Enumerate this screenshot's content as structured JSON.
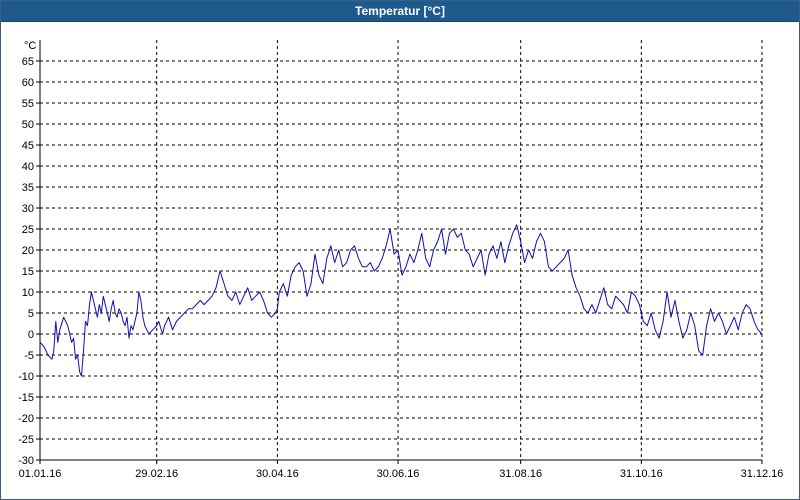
{
  "window": {
    "title": "Temperatur [°C]"
  },
  "chart_data": {
    "type": "line",
    "title": "Temperatur [°C]",
    "ylabel": "°C",
    "xlabel": "",
    "ylim": [
      -30,
      70
    ],
    "yticks": [
      -30,
      -25,
      -20,
      -15,
      -10,
      -5,
      0,
      5,
      10,
      15,
      20,
      25,
      30,
      35,
      40,
      45,
      50,
      55,
      60,
      65
    ],
    "x_ticks": [
      "01.01.16",
      "29.02.16",
      "30.04.16",
      "30.06.16",
      "31.08.16",
      "31.10.16",
      "31.12.16"
    ],
    "x_tick_days": [
      0,
      59,
      120,
      181,
      243,
      304,
      365
    ],
    "grid": true,
    "line_color": "#1010b0",
    "series": [
      {
        "name": "",
        "points": [
          [
            0,
            -2
          ],
          [
            2,
            -3
          ],
          [
            4,
            -5
          ],
          [
            6,
            -6
          ],
          [
            7,
            -4
          ],
          [
            8,
            3
          ],
          [
            9,
            -2
          ],
          [
            10,
            1
          ],
          [
            12,
            4
          ],
          [
            14,
            2
          ],
          [
            15,
            0
          ],
          [
            16,
            -2
          ],
          [
            17,
            -1
          ],
          [
            18,
            -6
          ],
          [
            19,
            -5
          ],
          [
            20,
            -9
          ],
          [
            21,
            -10
          ],
          [
            22,
            -4
          ],
          [
            23,
            3
          ],
          [
            24,
            2
          ],
          [
            25,
            7
          ],
          [
            26,
            10
          ],
          [
            27,
            8
          ],
          [
            28,
            6
          ],
          [
            29,
            4
          ],
          [
            30,
            7
          ],
          [
            31,
            5
          ],
          [
            32,
            9
          ],
          [
            33,
            7
          ],
          [
            34,
            5
          ],
          [
            35,
            3
          ],
          [
            36,
            6
          ],
          [
            37,
            8
          ],
          [
            38,
            5
          ],
          [
            39,
            4
          ],
          [
            40,
            6
          ],
          [
            41,
            5
          ],
          [
            42,
            3
          ],
          [
            43,
            2
          ],
          [
            44,
            4
          ],
          [
            45,
            -1
          ],
          [
            46,
            2
          ],
          [
            47,
            1
          ],
          [
            48,
            3
          ],
          [
            49,
            5
          ],
          [
            50,
            10
          ],
          [
            51,
            8
          ],
          [
            52,
            4
          ],
          [
            53,
            2
          ],
          [
            54,
            1
          ],
          [
            55,
            0
          ],
          [
            57,
            1
          ],
          [
            59,
            2
          ],
          [
            60,
            3
          ],
          [
            62,
            0
          ],
          [
            63,
            2
          ],
          [
            65,
            4
          ],
          [
            67,
            1
          ],
          [
            69,
            3
          ],
          [
            71,
            4
          ],
          [
            73,
            5
          ],
          [
            75,
            6
          ],
          [
            77,
            6
          ],
          [
            79,
            7
          ],
          [
            81,
            8
          ],
          [
            83,
            7
          ],
          [
            85,
            8
          ],
          [
            87,
            9
          ],
          [
            89,
            11
          ],
          [
            91,
            15
          ],
          [
            93,
            12
          ],
          [
            95,
            9
          ],
          [
            97,
            8
          ],
          [
            99,
            10
          ],
          [
            101,
            7
          ],
          [
            103,
            9
          ],
          [
            105,
            11
          ],
          [
            107,
            8
          ],
          [
            109,
            9
          ],
          [
            111,
            10
          ],
          [
            113,
            8
          ],
          [
            115,
            5
          ],
          [
            117,
            4
          ],
          [
            119,
            5
          ],
          [
            120,
            6
          ],
          [
            121,
            10
          ],
          [
            123,
            12
          ],
          [
            125,
            9
          ],
          [
            127,
            14
          ],
          [
            129,
            16
          ],
          [
            131,
            17
          ],
          [
            133,
            15
          ],
          [
            135,
            9
          ],
          [
            137,
            12
          ],
          [
            139,
            19
          ],
          [
            141,
            14
          ],
          [
            143,
            12
          ],
          [
            145,
            18
          ],
          [
            147,
            21
          ],
          [
            149,
            17
          ],
          [
            151,
            20
          ],
          [
            153,
            16
          ],
          [
            155,
            17
          ],
          [
            157,
            20
          ],
          [
            159,
            21
          ],
          [
            161,
            18
          ],
          [
            163,
            16
          ],
          [
            165,
            16
          ],
          [
            167,
            17
          ],
          [
            169,
            15
          ],
          [
            171,
            16
          ],
          [
            173,
            18
          ],
          [
            175,
            21
          ],
          [
            177,
            25
          ],
          [
            179,
            19
          ],
          [
            181,
            20
          ],
          [
            183,
            14
          ],
          [
            185,
            16
          ],
          [
            187,
            19
          ],
          [
            189,
            17
          ],
          [
            191,
            20
          ],
          [
            193,
            24
          ],
          [
            195,
            18
          ],
          [
            197,
            16
          ],
          [
            199,
            20
          ],
          [
            201,
            22
          ],
          [
            203,
            25
          ],
          [
            205,
            19
          ],
          [
            207,
            24
          ],
          [
            209,
            25
          ],
          [
            211,
            23
          ],
          [
            213,
            24
          ],
          [
            215,
            20
          ],
          [
            217,
            19
          ],
          [
            219,
            16
          ],
          [
            221,
            18
          ],
          [
            223,
            20
          ],
          [
            225,
            14
          ],
          [
            227,
            19
          ],
          [
            229,
            21
          ],
          [
            231,
            18
          ],
          [
            233,
            22
          ],
          [
            235,
            17
          ],
          [
            237,
            21
          ],
          [
            239,
            24
          ],
          [
            241,
            26
          ],
          [
            243,
            22
          ],
          [
            245,
            17
          ],
          [
            247,
            20
          ],
          [
            249,
            18
          ],
          [
            251,
            22
          ],
          [
            253,
            24
          ],
          [
            255,
            22
          ],
          [
            257,
            16
          ],
          [
            259,
            15
          ],
          [
            261,
            16
          ],
          [
            263,
            17
          ],
          [
            265,
            18
          ],
          [
            267,
            20
          ],
          [
            269,
            14
          ],
          [
            271,
            11
          ],
          [
            273,
            9
          ],
          [
            275,
            6
          ],
          [
            277,
            5
          ],
          [
            279,
            7
          ],
          [
            281,
            5
          ],
          [
            283,
            8
          ],
          [
            285,
            11
          ],
          [
            287,
            7
          ],
          [
            289,
            6
          ],
          [
            291,
            9
          ],
          [
            293,
            8
          ],
          [
            295,
            7
          ],
          [
            297,
            5
          ],
          [
            299,
            10
          ],
          [
            301,
            9
          ],
          [
            303,
            7
          ],
          [
            305,
            3
          ],
          [
            307,
            2
          ],
          [
            309,
            5
          ],
          [
            311,
            1
          ],
          [
            313,
            -1
          ],
          [
            315,
            3
          ],
          [
            317,
            10
          ],
          [
            319,
            4
          ],
          [
            321,
            8
          ],
          [
            323,
            3
          ],
          [
            325,
            -1
          ],
          [
            327,
            1
          ],
          [
            329,
            5
          ],
          [
            331,
            2
          ],
          [
            333,
            -4
          ],
          [
            335,
            -5
          ],
          [
            337,
            2
          ],
          [
            339,
            6
          ],
          [
            341,
            3
          ],
          [
            343,
            5
          ],
          [
            345,
            3
          ],
          [
            347,
            0
          ],
          [
            349,
            2
          ],
          [
            351,
            4
          ],
          [
            353,
            1
          ],
          [
            355,
            5
          ],
          [
            357,
            7
          ],
          [
            359,
            6
          ],
          [
            361,
            3
          ],
          [
            363,
            1
          ],
          [
            365,
            0
          ]
        ]
      }
    ]
  }
}
